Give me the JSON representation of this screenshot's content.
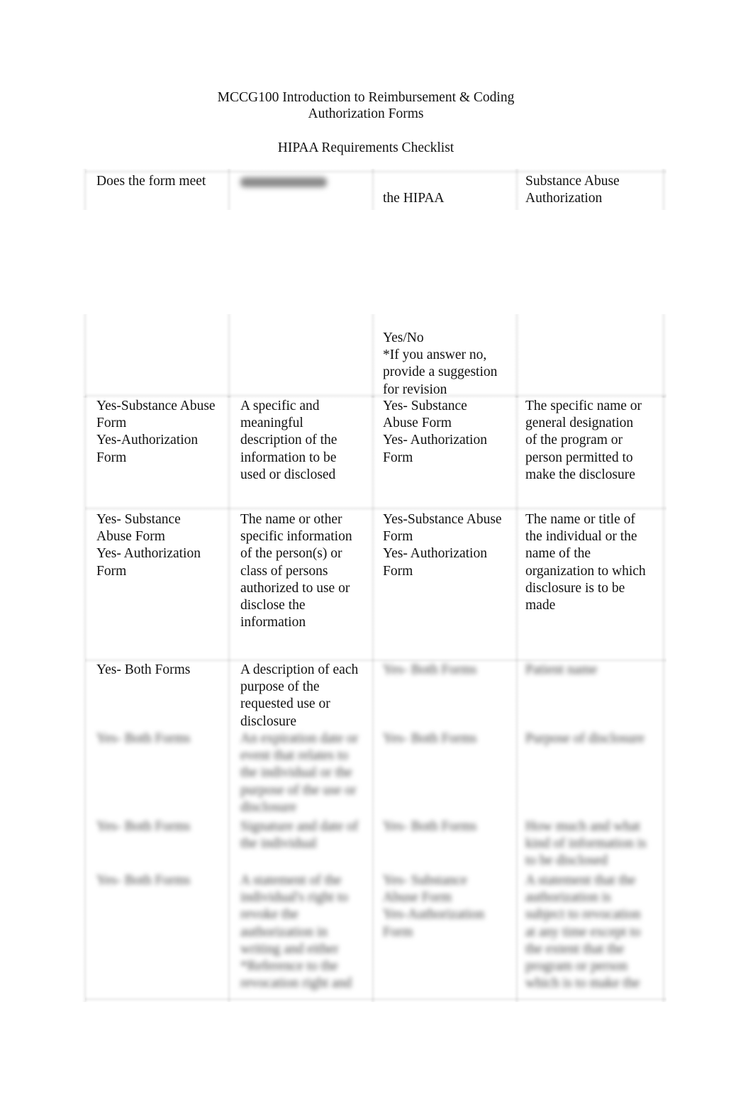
{
  "document": {
    "course_title": "MCCG100 Introduction to Reimbursement & Coding",
    "subtitle": "Authorization Forms",
    "checklist_title": "HIPAA Requirements Checklist"
  },
  "table": {
    "header_top": {
      "col1": "Does the form meet",
      "col2": "Authorization",
      "col3": "the HIPAA",
      "col4": "Substance Abuse\nAuthorization"
    },
    "header_bottom": {
      "col3": "Yes/No\n*If you answer no,\nprovide a suggestion\nfor revision"
    },
    "rows": [
      {
        "col1": "Yes-Substance Abuse\nForm\nYes-Authorization\nForm",
        "col2": "A specific and\nmeaningful\ndescription of the\ninformation to be\nused or disclosed",
        "col3": "Yes- Substance\nAbuse Form\nYes- Authorization\nForm",
        "col4": "The specific name or\ngeneral designation\nof the program or\nperson permitted to\nmake the disclosure"
      },
      {
        "col1": "Yes- Substance\nAbuse Form\nYes- Authorization\nForm",
        "col2": "The name or other\nspecific information\nof the person(s) or\nclass of persons\nauthorized to use or\ndisclose the\ninformation",
        "col3": "Yes-Substance Abuse\nForm\nYes- Authorization\nForm",
        "col4": "The name or title of\nthe individual or the\nname of the\norganization to which\ndisclosure is to be\nmade"
      },
      {
        "col1": "Yes- Both Forms",
        "col2": "A description of each\npurpose of the\nrequested use or\ndisclosure",
        "col3": "Yes- Both Forms",
        "col4": "Patient name"
      },
      {
        "col1": "Yes- Both Forms",
        "col2": "An expiration date or\nevent that relates to\nthe individual or the\npurpose of the use or\ndisclosure",
        "col3": "Yes- Both Forms",
        "col4": "Purpose of disclosure"
      },
      {
        "col1": "Yes- Both Forms",
        "col2": "Signature and date of\nthe individual",
        "col3": "Yes- Both Forms",
        "col4": "How much and what\nkind of information is\nto be disclosed"
      },
      {
        "col1": "Yes- Both Forms",
        "col2": "A statement of the\nindividual's right to\nrevoke the\nauthorization in\nwriting and either\n*Reference to the\nrevocation right and",
        "col3": "Yes- Substance\nAbuse Form\nYes-Authorization\nForm",
        "col4": "A statement that the\nauthorization is\nsubject to revocation\nat any time except to\nthe extent that the\nprogram or person\nwhich is to make the"
      }
    ]
  }
}
